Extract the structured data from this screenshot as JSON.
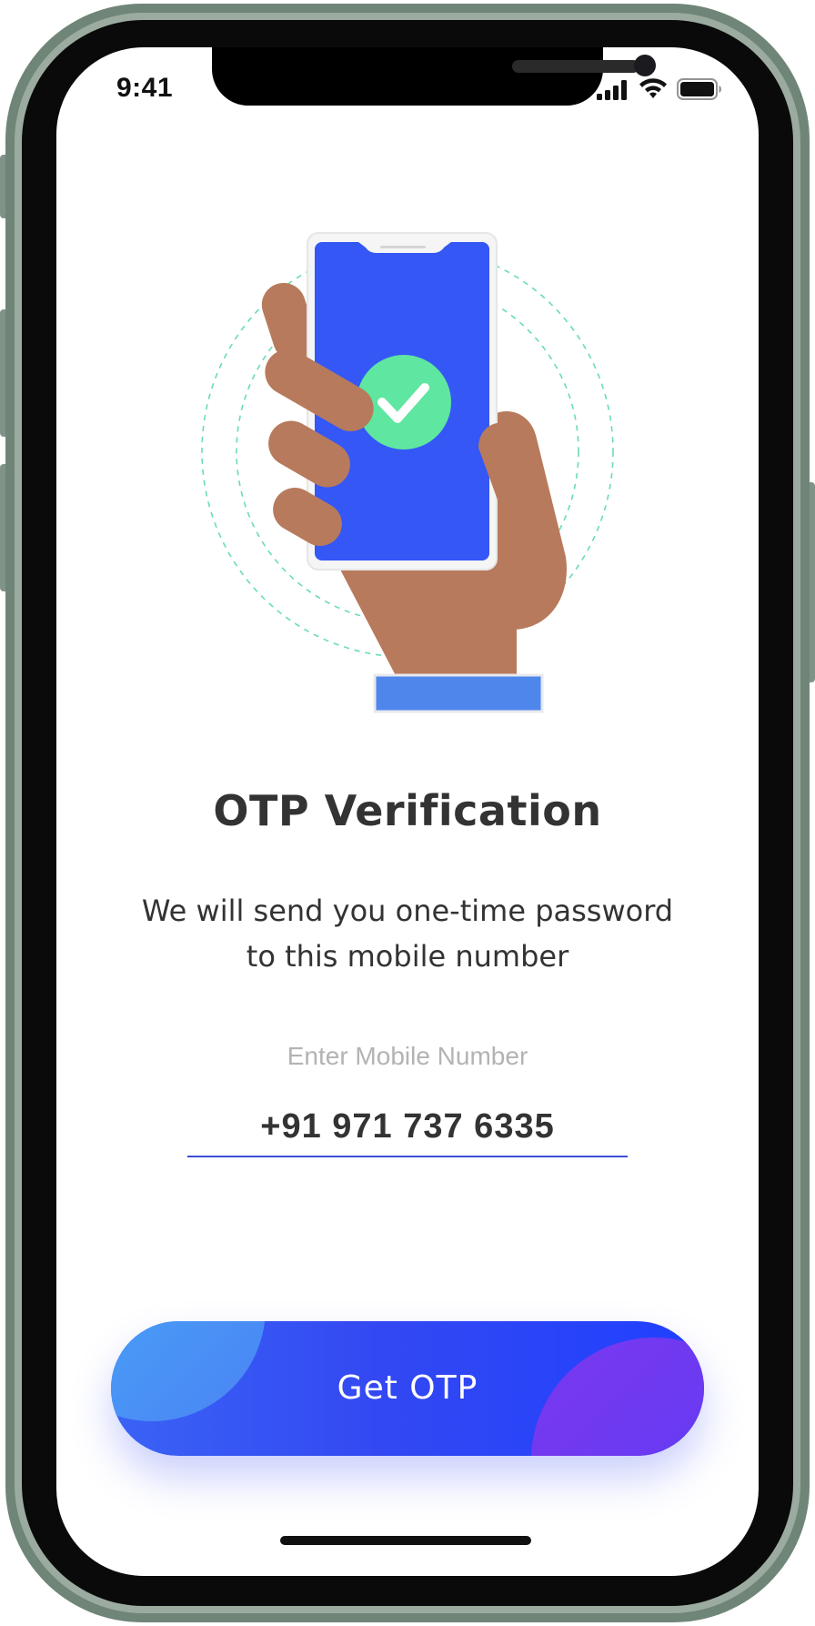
{
  "status_bar": {
    "time": "9:41",
    "icons": [
      "signal-icon",
      "wifi-icon",
      "battery-icon"
    ]
  },
  "illustration": {
    "icon": "hand-holding-phone-checkmark-illustration"
  },
  "main": {
    "title": "OTP Verification",
    "subtitle_line1": "We will send you one-time password",
    "subtitle_line2": "to this mobile number"
  },
  "phone_field": {
    "label": "Enter Mobile Number",
    "value": "+91 971 737 6335"
  },
  "cta": {
    "label": "Get OTP"
  },
  "colors": {
    "accent": "#3348f2",
    "phone_screen": "#3457f6",
    "check_circle": "#5fe6a0",
    "skin": "#b87a5c",
    "sleeve": "#4f86ec"
  }
}
